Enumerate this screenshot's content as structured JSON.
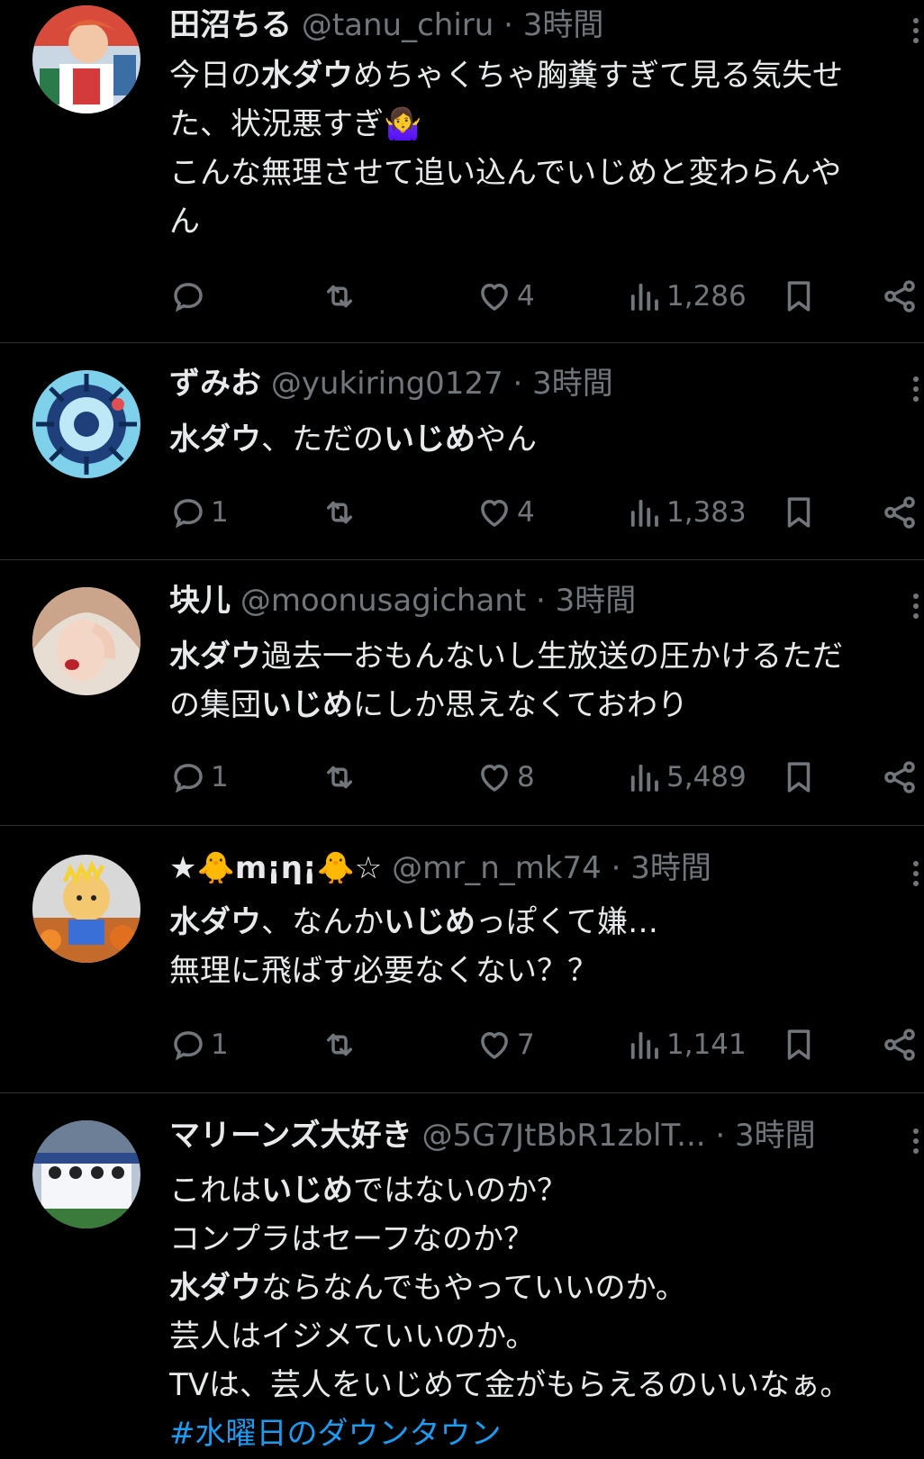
{
  "colors": {
    "background": "#000000",
    "text": "#e7e9ea",
    "muted": "#71767b",
    "link": "#1d9bf0",
    "divider": "#2f3336"
  },
  "icons": {
    "reply": "reply-icon",
    "retweet": "retweet-icon",
    "like": "heart-icon",
    "views": "views-icon",
    "bookmark": "bookmark-icon",
    "share": "share-icon",
    "more": "more-options-icon"
  },
  "tweets": [
    {
      "display_name": "田沼ちる",
      "handle": "@tanu_chiru",
      "time": "· 3時間",
      "lines": [
        [
          {
            "t": "今日の",
            "b": false
          },
          {
            "t": "水ダウ",
            "b": true
          },
          {
            "t": "めちゃくちゃ胸糞すぎて見る気失せ",
            "b": false
          }
        ],
        [
          {
            "t": "た、状況悪すぎ🤷‍♀️",
            "b": false
          }
        ],
        [
          {
            "t": "こんな無理させて追い込んでいじめと変わらんや",
            "b": false
          }
        ],
        [
          {
            "t": "ん",
            "b": false
          }
        ]
      ],
      "replies": "",
      "retweets": "",
      "likes": "4",
      "views": "1,286"
    },
    {
      "display_name": "ずみお",
      "handle": "@yukiring0127",
      "time": "· 3時間",
      "lines": [
        [
          {
            "t": "水ダウ",
            "b": true
          },
          {
            "t": "、ただの",
            "b": false
          },
          {
            "t": "いじめ",
            "b": true
          },
          {
            "t": "やん",
            "b": false
          }
        ]
      ],
      "replies": "1",
      "retweets": "",
      "likes": "4",
      "views": "1,383"
    },
    {
      "display_name": "块儿",
      "handle": "@moonusagichant",
      "time": "· 3時間",
      "lines": [
        [
          {
            "t": "水ダウ",
            "b": true
          },
          {
            "t": "過去一おもんないし生放送の圧かけるただ",
            "b": false
          }
        ],
        [
          {
            "t": "の集団",
            "b": false
          },
          {
            "t": "いじめ",
            "b": true
          },
          {
            "t": "にしか思えなくておわり",
            "b": false
          }
        ]
      ],
      "replies": "1",
      "retweets": "",
      "likes": "8",
      "views": "5,489"
    },
    {
      "display_name": "★🐥m¡η¡🐥☆",
      "handle": "@mr_n_mk74",
      "time": "· 3時間",
      "lines": [
        [
          {
            "t": "水ダウ",
            "b": true
          },
          {
            "t": "、なんか",
            "b": false
          },
          {
            "t": "いじめ",
            "b": true
          },
          {
            "t": "っぽくて嫌…",
            "b": false
          }
        ],
        [
          {
            "t": "無理に飛ばす必要なくない？？",
            "b": false
          }
        ]
      ],
      "replies": "1",
      "retweets": "",
      "likes": "7",
      "views": "1,141"
    },
    {
      "display_name": "マリーンズ大好き",
      "handle": "@5G7JtBbR1zblT...",
      "time": "· 3時間",
      "lines": [
        [
          {
            "t": "これは",
            "b": false
          },
          {
            "t": "いじめ",
            "b": true
          },
          {
            "t": "ではないのか？",
            "b": false
          }
        ],
        [
          {
            "t": "コンプラはセーフなのか？",
            "b": false
          }
        ],
        [
          {
            "t": "水ダウ",
            "b": true
          },
          {
            "t": "ならなんでもやっていいのか。",
            "b": false
          }
        ],
        [
          {
            "t": "芸人はイジメていいのか。",
            "b": false
          }
        ],
        [
          {
            "t": "TVは、芸人をいじめて金がもらえるのいいなぁ。",
            "b": false
          }
        ]
      ],
      "hashtag": "#水曜日のダウンタウン"
    }
  ]
}
